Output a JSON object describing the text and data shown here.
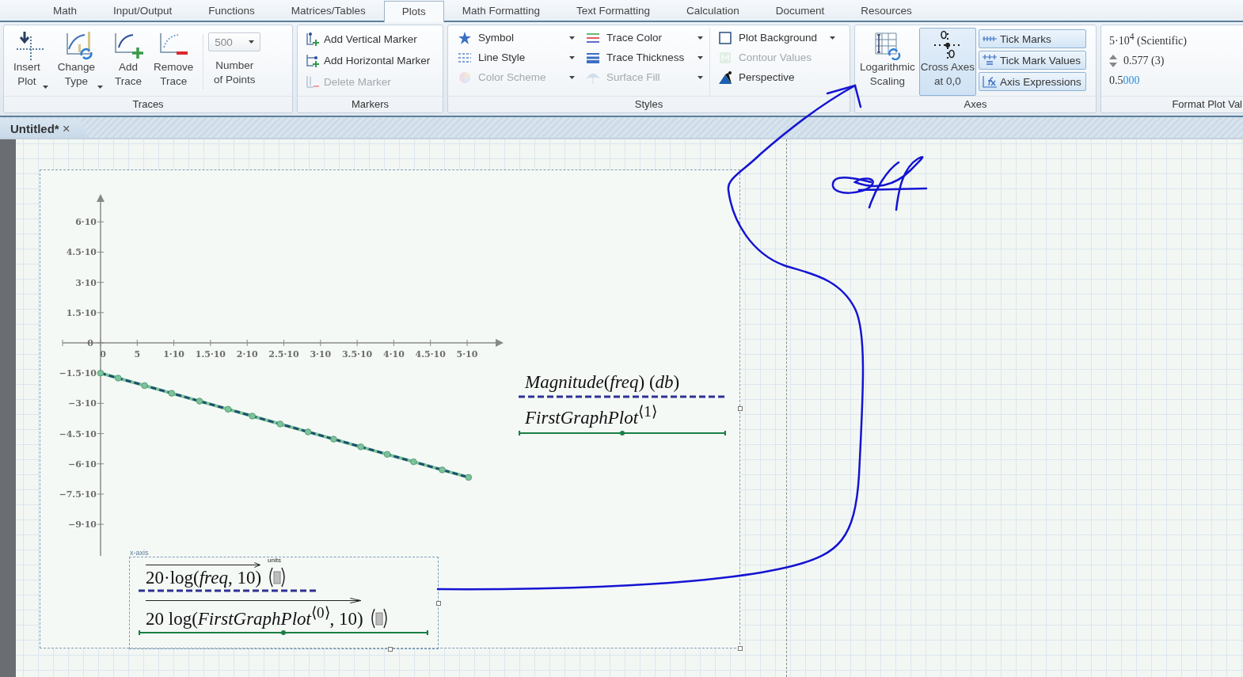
{
  "menu_tabs": [
    {
      "label": "Math",
      "selected": false
    },
    {
      "label": "Input/Output",
      "selected": false
    },
    {
      "label": "Functions",
      "selected": false
    },
    {
      "label": "Matrices/Tables",
      "selected": false
    },
    {
      "label": "Plots",
      "selected": true
    },
    {
      "label": "Math Formatting",
      "selected": false
    },
    {
      "label": "Text Formatting",
      "selected": false
    },
    {
      "label": "Calculation",
      "selected": false
    },
    {
      "label": "Document",
      "selected": false
    },
    {
      "label": "Resources",
      "selected": false
    }
  ],
  "ribbon": {
    "traces": {
      "title": "Traces",
      "buttons": [
        {
          "label": "Insert\nPlot",
          "dropdown": true
        },
        {
          "label": "Change\nType",
          "dropdown": true
        },
        {
          "label": "Add\nTrace",
          "dropdown": false
        },
        {
          "label": "Remove\nTrace",
          "dropdown": false
        }
      ],
      "points": {
        "value": "500",
        "disabled": true
      },
      "points_label": "Number\nof Points"
    },
    "markers": {
      "title": "Markers",
      "items": [
        {
          "label": "Add Vertical Marker",
          "disabled": false
        },
        {
          "label": "Add Horizontal Marker",
          "disabled": false
        },
        {
          "label": "Delete Marker",
          "disabled": true
        }
      ]
    },
    "styles": {
      "title": "Styles",
      "columns": [
        [
          {
            "label": "Symbol",
            "dropdown": true,
            "disabled": false
          },
          {
            "label": "Line Style",
            "dropdown": true,
            "disabled": false
          },
          {
            "label": "Color Scheme",
            "dropdown": true,
            "disabled": true
          }
        ],
        [
          {
            "label": "Trace Color",
            "dropdown": true,
            "disabled": false
          },
          {
            "label": "Trace Thickness",
            "dropdown": true,
            "disabled": false
          },
          {
            "label": "Surface Fill",
            "dropdown": true,
            "disabled": true
          }
        ],
        [
          {
            "label": "Plot Background",
            "dropdown": true,
            "disabled": false
          },
          {
            "label": "Contour Values",
            "dropdown": false,
            "disabled": true
          },
          {
            "label": "Perspective",
            "dropdown": false,
            "disabled": false
          }
        ]
      ]
    },
    "axes": {
      "title": "Axes",
      "scaling": {
        "label": "Logarithmic\nScaling",
        "selected": false
      },
      "cross": {
        "label": "Cross Axes\nat 0,0",
        "selected": true
      },
      "toggles": [
        {
          "label": "Tick Marks",
          "selected": true
        },
        {
          "label": "Tick Mark Values",
          "selected": true
        },
        {
          "label": "Axis Expressions",
          "selected": true
        }
      ]
    },
    "format": {
      "title": "Format Plot Val",
      "scientific": "5·10$^{4}$ (Scientific)",
      "precision": "0.577 (3)",
      "sample": {
        "digits": "0.5",
        "trailing": "000"
      }
    }
  },
  "document_tab": {
    "title": "Untitled*",
    "close": "×"
  },
  "plot": {
    "x_tick_labels": [
      "0",
      "5",
      "1·10",
      "1.5·10",
      "2·10",
      "2.5·10",
      "3·10",
      "3.5·10",
      "4·10",
      "4.5·10",
      "5·10"
    ],
    "y_tick_labels": [
      "6·10",
      "4.5·10",
      "3·10",
      "1.5·10",
      "0",
      "−1.5·10",
      "−3·10",
      "−4.5·10",
      "−6·10",
      "−7.5·10",
      "−9·10"
    ],
    "legend": [
      {
        "text": "*Magnitude*(*freq*) (*db*)",
        "color": "#2e3192",
        "kind": "dash"
      },
      {
        "text": "*FirstGraphPlot*$^{⟨1⟩}$",
        "color": "#1a7f45",
        "kind": "marker"
      }
    ],
    "x_axis": {
      "label": "x-axis",
      "expressions": [
        {
          "text": "20·log(*freq*, 10)",
          "units_label": "units",
          "color": "#2e3192",
          "kind": "dash"
        },
        {
          "text": "20 log(*FirstGraphPlot*$^{⟨0⟩}$, 10)",
          "color": "#1a7f45",
          "kind": "marker"
        }
      ]
    }
  }
}
